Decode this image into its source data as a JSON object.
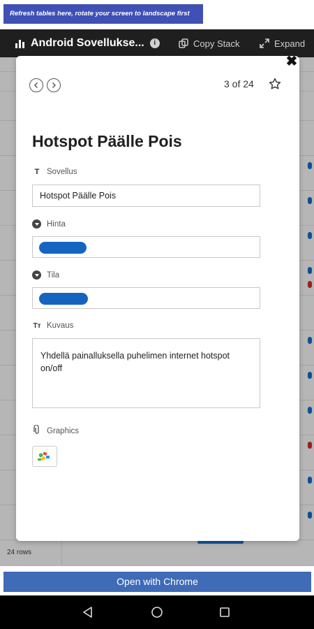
{
  "banner": {
    "text": "Refresh tables here, rotate your screen to landscape first"
  },
  "header": {
    "title": "Android Sovellukse...",
    "copy_stack_label": "Copy Stack",
    "expand_label": "Expand"
  },
  "background": {
    "rows_count": "24 rows"
  },
  "record": {
    "counter": "3 of 24",
    "title": "Hotspot Päälle Pois",
    "fields": {
      "sovellus": {
        "label": "Sovellus",
        "value": "Hotspot Päälle Pois",
        "icon": "text-field-icon"
      },
      "hinta": {
        "label": "Hinta",
        "icon": "dropdown-icon",
        "pill_color": "#1565c0"
      },
      "tila": {
        "label": "Tila",
        "icon": "dropdown-icon",
        "pill_color": "#1565c0"
      },
      "kuvaus": {
        "label": "Kuvaus",
        "value": "Yhdellä painalluksella puhelimen internet hotspot on/off",
        "icon": "long-text-icon"
      },
      "graphics": {
        "label": "Graphics",
        "icon": "attachment-icon"
      }
    }
  },
  "footer": {
    "open_chrome_label": "Open with Chrome"
  },
  "colors": {
    "banner": "#3f51b5",
    "header": "#1f1f1f",
    "pill": "#1565c0",
    "chrome_button": "#3f6bb7"
  }
}
